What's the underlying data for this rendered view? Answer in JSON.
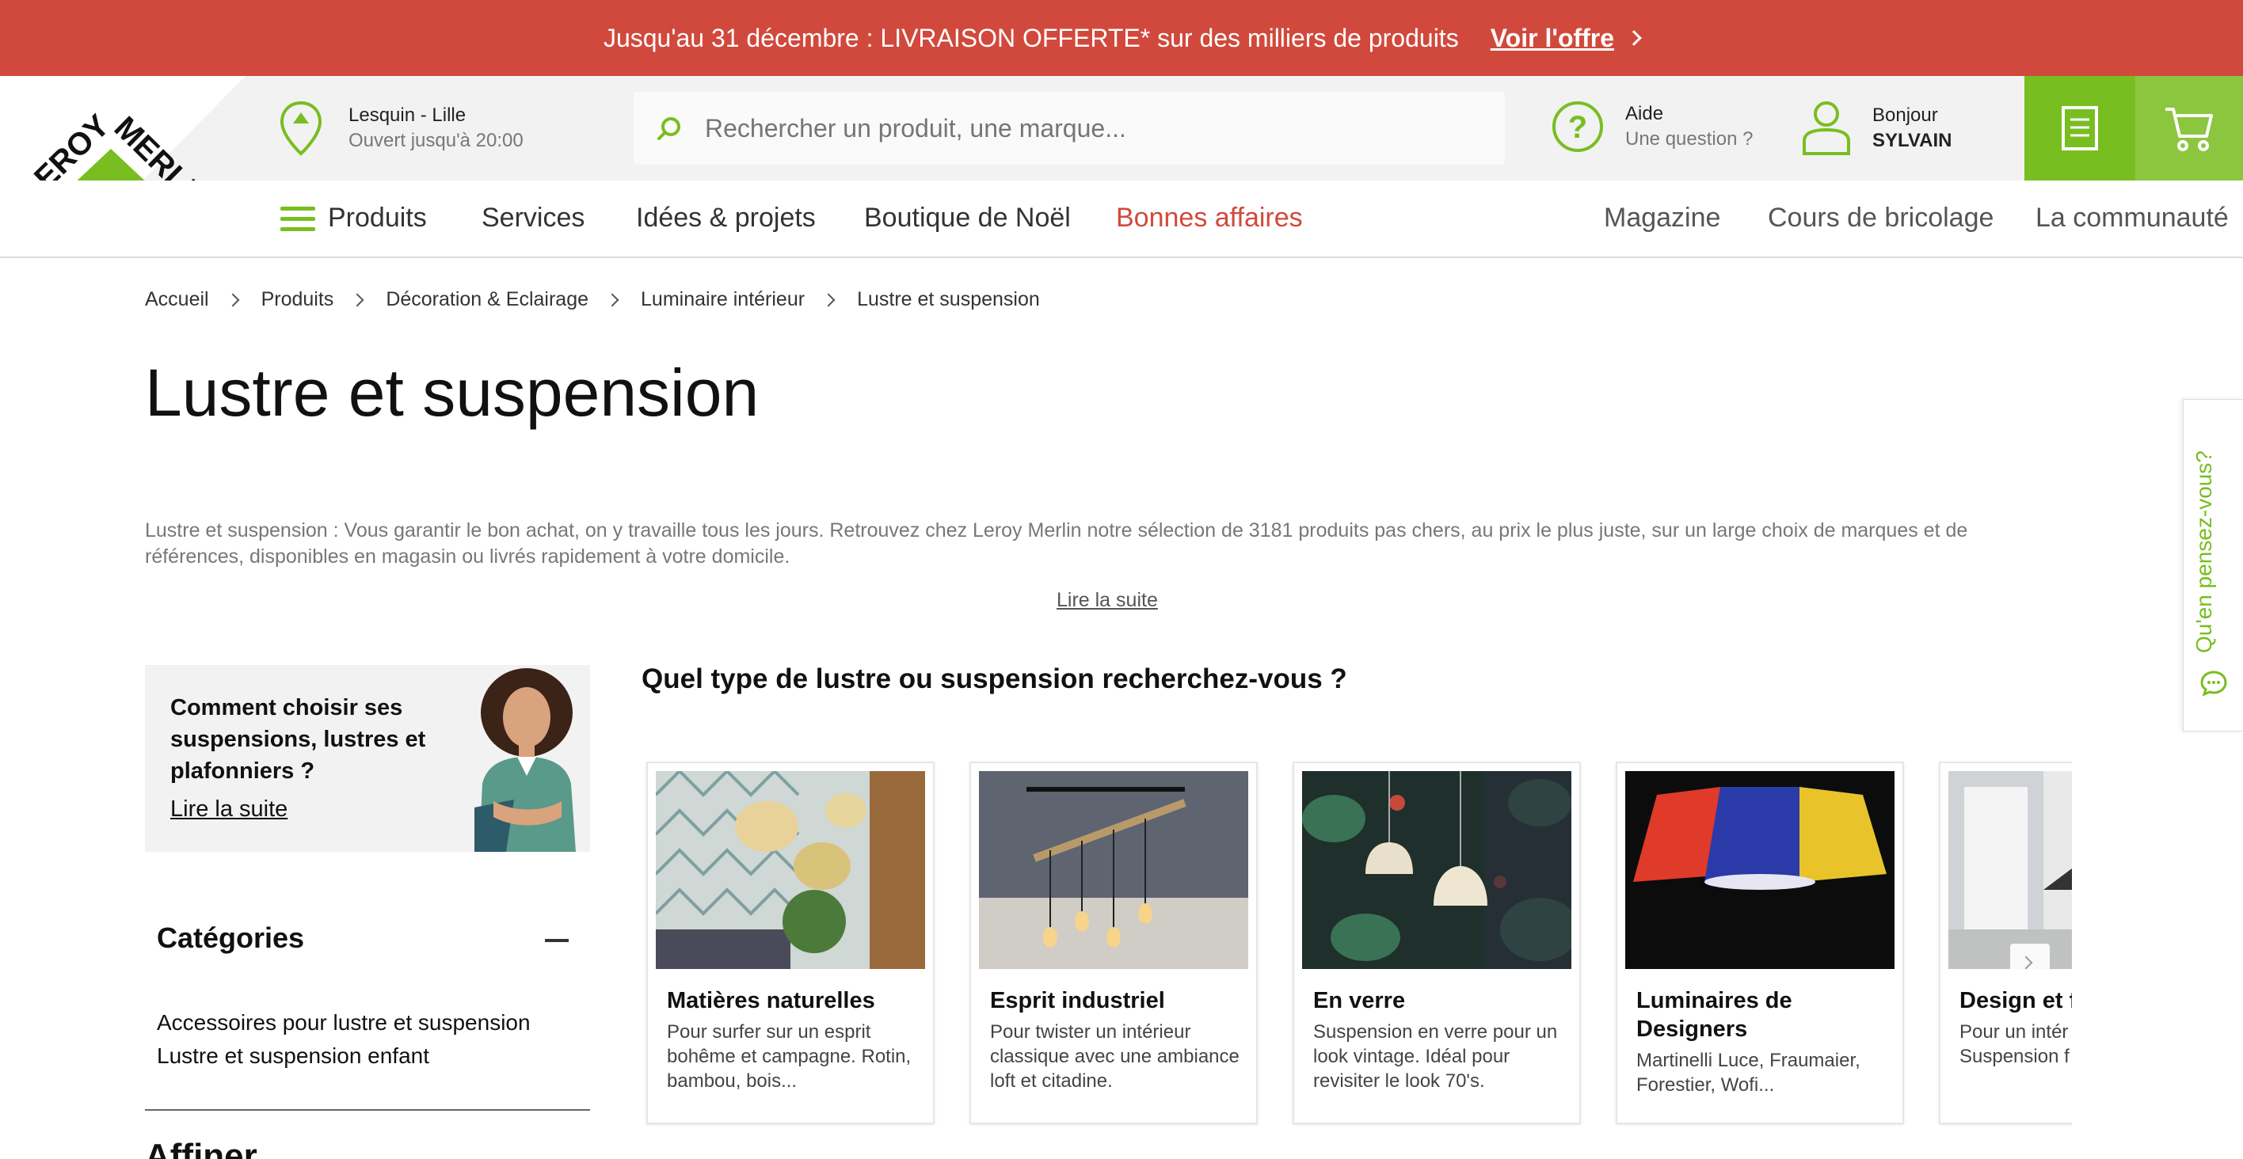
{
  "promo": {
    "text": "Jusqu'au 31 décembre : LIVRAISON OFFERTE* sur des milliers de produits",
    "link": "Voir l'offre"
  },
  "brand": {
    "line1": "LEROY",
    "line2": "MERLIN",
    "green": "#78be20",
    "red": "#d1493c"
  },
  "header": {
    "store_name": "Lesquin - Lille",
    "store_hours": "Ouvert jusqu'à 20:00",
    "search_placeholder": "Rechercher un produit, une marque...",
    "help_title": "Aide",
    "help_sub": "Une question ?",
    "account_greeting": "Bonjour",
    "account_name": "SYLVAIN"
  },
  "nav": {
    "products": "Produits",
    "services": "Services",
    "ideas": "Idées & projets",
    "christmas": "Boutique de Noël",
    "deals": "Bonnes affaires",
    "magazine": "Magazine",
    "courses": "Cours de bricolage",
    "community": "La communauté"
  },
  "breadcrumb": [
    "Accueil",
    "Produits",
    "Décoration & Eclairage",
    "Luminaire intérieur",
    "Lustre et suspension"
  ],
  "page": {
    "title": "Lustre et suspension",
    "description": "Lustre et suspension : Vous garantir le bon achat, on y travaille tous les jours. Retrouvez chez Leroy Merlin notre sélection de 3181 produits pas chers, au prix le plus juste, sur un large choix de marques et de références, disponibles en magasin ou livrés rapidement à votre domicile.",
    "read_more": "Lire la suite"
  },
  "guide": {
    "text": "Comment choisir ses suspensions, lustres et plafonniers ?",
    "link": "Lire la suite"
  },
  "categories": {
    "title": "Catégories",
    "items": [
      "Accessoires pour lustre et suspension",
      "Lustre et suspension enfant"
    ]
  },
  "affiner": "Affiner",
  "types": {
    "title": "Quel type de lustre ou suspension recherchez-vous ?",
    "cards": [
      {
        "title": "Matières naturelles",
        "desc": "Pour surfer sur un esprit bohême et campagne. Rotin, bambou, bois..."
      },
      {
        "title": "Esprit industriel",
        "desc": "Pour twister un intérieur classique avec une ambiance loft et citadine."
      },
      {
        "title": "En verre",
        "desc": "Suspension en verre pour un look vintage. Idéal pour revisiter le look 70's."
      },
      {
        "title": "Luminaires de Designers",
        "desc": "Martinelli Luce, Fraumaier, Forestier, Wofi..."
      },
      {
        "title": "Design et f",
        "desc": "Pour un intér moderne voi Suspension f"
      }
    ]
  },
  "feedback": "Qu'en pensez-vous?"
}
